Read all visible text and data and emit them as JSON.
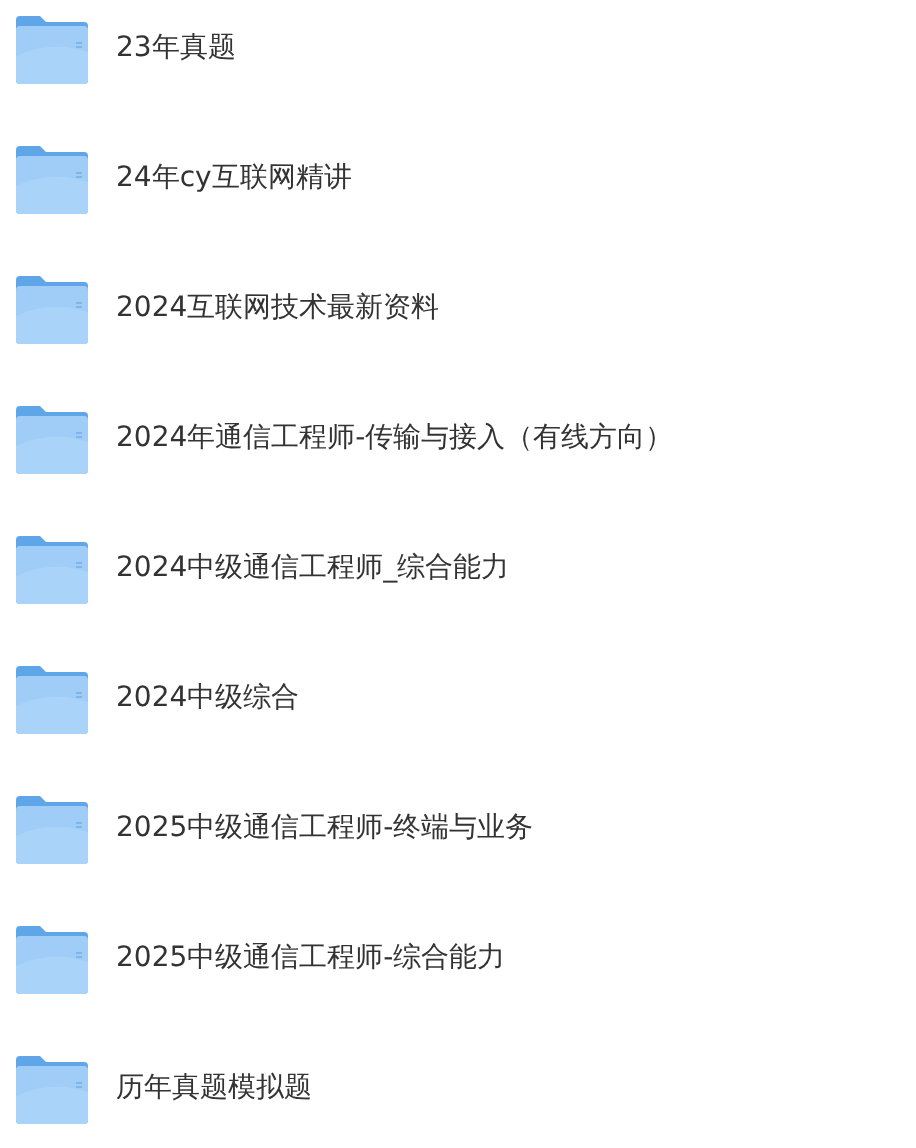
{
  "folders": [
    {
      "name": "23年真题"
    },
    {
      "name": "24年cy互联网精讲"
    },
    {
      "name": "2024互联网技术最新资料"
    },
    {
      "name": "2024年通信工程师-传输与接入（有线方向）"
    },
    {
      "name": "2024中级通信工程师_综合能力"
    },
    {
      "name": "2024中级综合"
    },
    {
      "name": "2025中级通信工程师-终端与业务"
    },
    {
      "name": "2025中级通信工程师-综合能力"
    },
    {
      "name": "历年真题模拟题"
    }
  ]
}
